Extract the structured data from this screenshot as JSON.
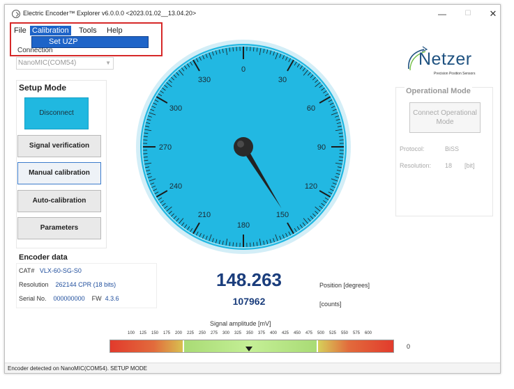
{
  "window": {
    "title": "Electric Encoder™ Explorer v6.0.0.0  <2023.01.02__13.04.20>",
    "controls": {
      "minimize": "—",
      "maximize": "☐",
      "close": "✕"
    }
  },
  "menu": {
    "file": "File",
    "calibration": "Calibration",
    "tools": "Tools",
    "help": "Help",
    "dropdown_item": "Set UZP"
  },
  "connection": {
    "label": "Connection",
    "selected": "NanoMIC(COM54)"
  },
  "setup": {
    "title": "Setup Mode",
    "disconnect": "Disconnect",
    "signal_verification": "Signal verification",
    "manual_calibration": "Manual calibration",
    "auto_calibration": "Auto-calibration",
    "parameters": "Parameters"
  },
  "encoder": {
    "title": "Encoder data",
    "cat_label": "CAT#",
    "cat_value": "VLX-60-SG-S0",
    "resolution_label": "Resolution",
    "resolution_value": "262144 CPR (18 bits)",
    "serial_label": "Serial No.",
    "serial_value": "000000000",
    "fw_label": "FW",
    "fw_value": "4.3.6"
  },
  "gauge": {
    "labels": [
      "0",
      "30",
      "60",
      "90",
      "120",
      "150",
      "180",
      "210",
      "240",
      "270",
      "300",
      "330"
    ],
    "angle_degrees": 148.263,
    "accent_color": "#25bde6"
  },
  "readout": {
    "position": "148.263",
    "position_unit": "Position [degrees]",
    "counts": "107962",
    "counts_unit": "[counts]"
  },
  "logo": {
    "name": "Netzer",
    "tagline": "Precision Position Sensors"
  },
  "operational": {
    "title": "Operational Mode",
    "button": "Connect Operational Mode",
    "protocol_label": "Protocol:",
    "protocol_value": "BiSS",
    "resolution_label": "Resolution:",
    "resolution_value": "18",
    "resolution_unit": "[bit]"
  },
  "signal": {
    "title": "Signal amplitude [mV]",
    "ticks": [
      "100",
      "125",
      "150",
      "175",
      "200",
      "225",
      "250",
      "275",
      "300",
      "325",
      "350",
      "375",
      "400",
      "425",
      "450",
      "475",
      "500",
      "525",
      "550",
      "575",
      "600"
    ],
    "current_value": "0",
    "pointer_mV": 350
  },
  "status": {
    "text": "Encoder detected on NanoMIC(COM54). SETUP MODE"
  }
}
